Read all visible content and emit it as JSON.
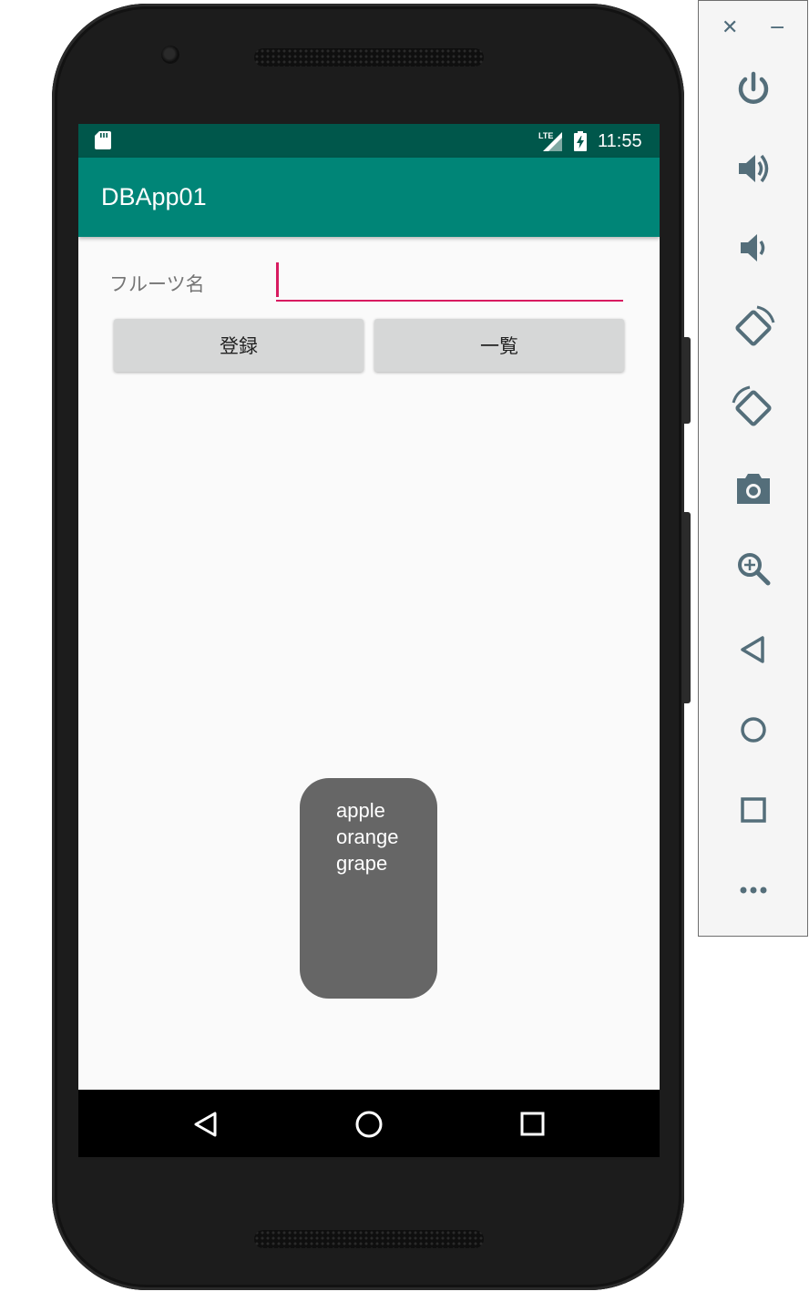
{
  "status_bar": {
    "time": "11:55",
    "network": "LTE"
  },
  "app_bar": {
    "title": "DBApp01"
  },
  "form": {
    "fruit_label": "フルーツ名",
    "fruit_value": "",
    "register_button": "登録",
    "list_button": "一覧"
  },
  "toast": {
    "lines": [
      "apple",
      "orange",
      "grape"
    ]
  },
  "emulator_panel": {
    "close_glyph": "✕",
    "minimize_glyph": "−",
    "icons": [
      "power-icon",
      "volume-up-icon",
      "volume-down-icon",
      "rotate-left-icon",
      "rotate-right-icon",
      "camera-icon",
      "zoom-icon",
      "back-icon",
      "home-icon",
      "overview-icon",
      "more-icon"
    ]
  },
  "colors": {
    "primary": "#008577",
    "primary_dark": "#00574b",
    "accent": "#d81b60",
    "toast_bg": "#666666",
    "panel_icon": "#546e7a"
  }
}
